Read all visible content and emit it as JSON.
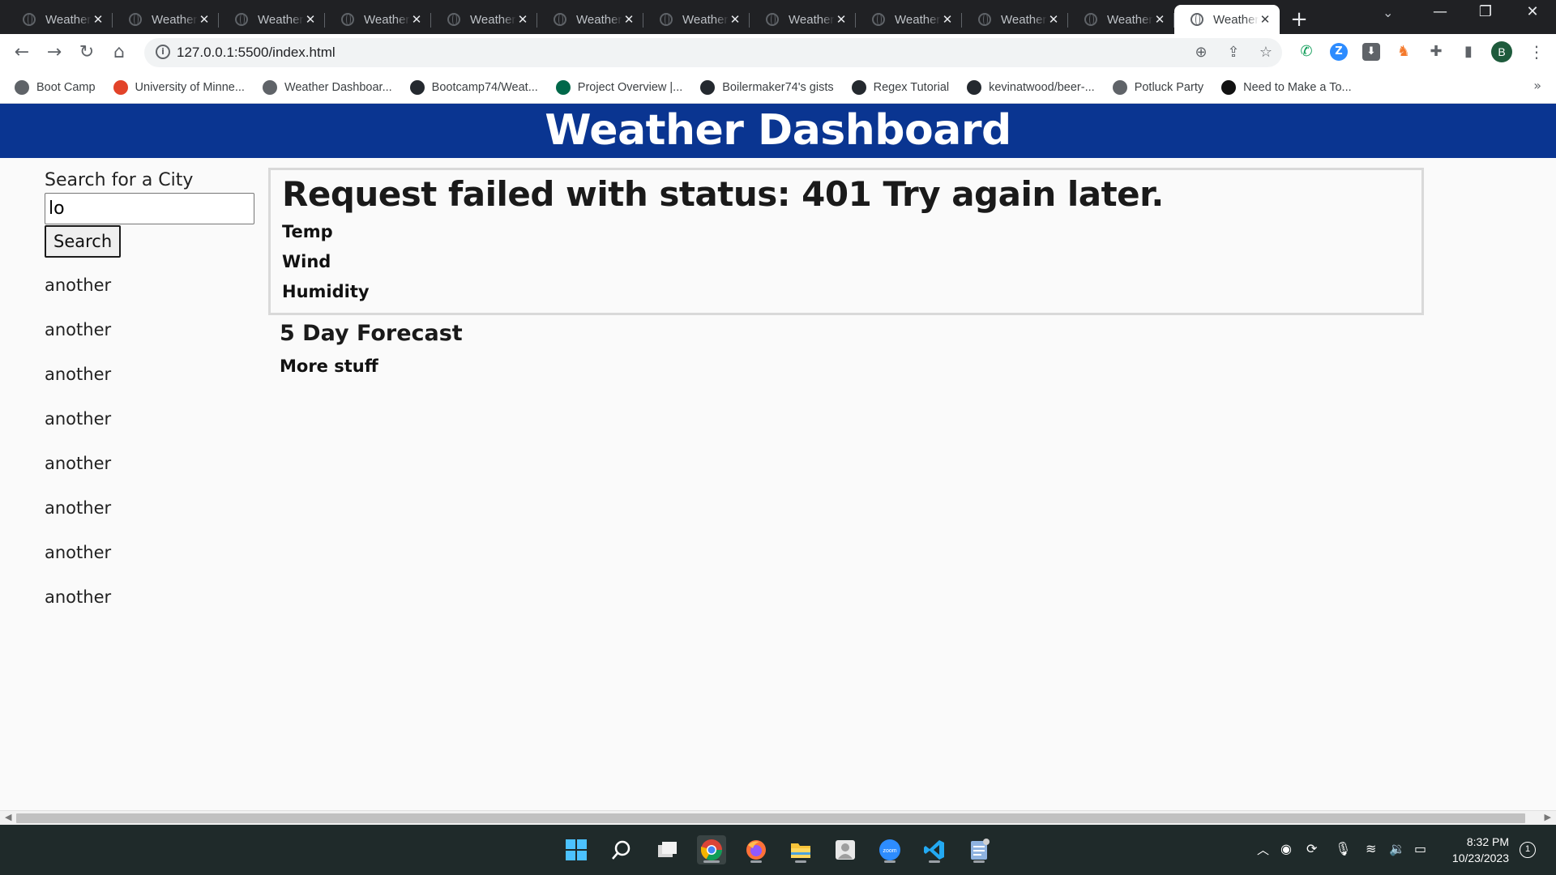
{
  "browser": {
    "tabs": [
      {
        "title": "Weather Dashboard",
        "close": "✕"
      },
      {
        "title": "Weather Dashboard",
        "close": "✕"
      },
      {
        "title": "Weather Dashboard",
        "close": "✕"
      },
      {
        "title": "Weather Dashboard",
        "close": "✕"
      },
      {
        "title": "Weather Dashboard",
        "close": "✕"
      },
      {
        "title": "Weather Dashboard",
        "close": "✕"
      },
      {
        "title": "Weather Dashboard",
        "close": "✕"
      },
      {
        "title": "Weather Dashboard",
        "close": "✕"
      },
      {
        "title": "Weather Dashboard",
        "close": "✕"
      },
      {
        "title": "Weather Dashboard",
        "close": "✕"
      },
      {
        "title": "Weather Dashboard",
        "close": "✕"
      },
      {
        "title": "Weather Dashboard",
        "close": "✕",
        "active": true
      }
    ],
    "new_tab": "+",
    "address_bar": {
      "url": "127.0.0.1:5500/index.html"
    },
    "profile_initial": "B",
    "bookmarks": [
      {
        "label": "Boot Camp",
        "icon": "globe-icon",
        "color": "#5f6368"
      },
      {
        "label": "University of Minne...",
        "icon": "gitlab-icon",
        "color": "#e24329"
      },
      {
        "label": "Weather Dashboar...",
        "icon": "globe-icon",
        "color": "#5f6368"
      },
      {
        "label": "Bootcamp74/Weat...",
        "icon": "github-icon",
        "color": "#24292f"
      },
      {
        "label": "Project Overview |...",
        "icon": "mongodb-icon",
        "color": "#00684a"
      },
      {
        "label": "Boilermaker74's gists",
        "icon": "github-icon",
        "color": "#24292f"
      },
      {
        "label": "Regex Tutorial",
        "icon": "github-icon",
        "color": "#24292f"
      },
      {
        "label": "kevinatwood/beer-...",
        "icon": "github-icon",
        "color": "#24292f"
      },
      {
        "label": "Potluck Party",
        "icon": "globe-icon",
        "color": "#5f6368"
      },
      {
        "label": "Need to Make a To...",
        "icon": "codepen-icon",
        "color": "#111111"
      }
    ],
    "bookmarks_overflow": "»"
  },
  "page": {
    "header_title": "Weather Dashboard",
    "search": {
      "label": "Search for a City",
      "value": "lo",
      "button_label": "Search"
    },
    "history": [
      "another",
      "another",
      "another",
      "another",
      "another",
      "another",
      "another",
      "another"
    ],
    "current": {
      "title": "Request failed with status: 401 Try again later.",
      "temp_label": "Temp",
      "wind_label": "Wind",
      "humidity_label": "Humidity"
    },
    "forecast": {
      "title": "5 Day Forecast",
      "content": "More stuff"
    }
  },
  "taskbar": {
    "time": "8:32 PM",
    "date": "10/23/2023",
    "notification_count": "1"
  },
  "colors": {
    "header_bg": "#0a3591",
    "page_bg": "#fafafa",
    "tabbar_bg": "#202124",
    "taskbar_bg": "#1f2a2a"
  }
}
